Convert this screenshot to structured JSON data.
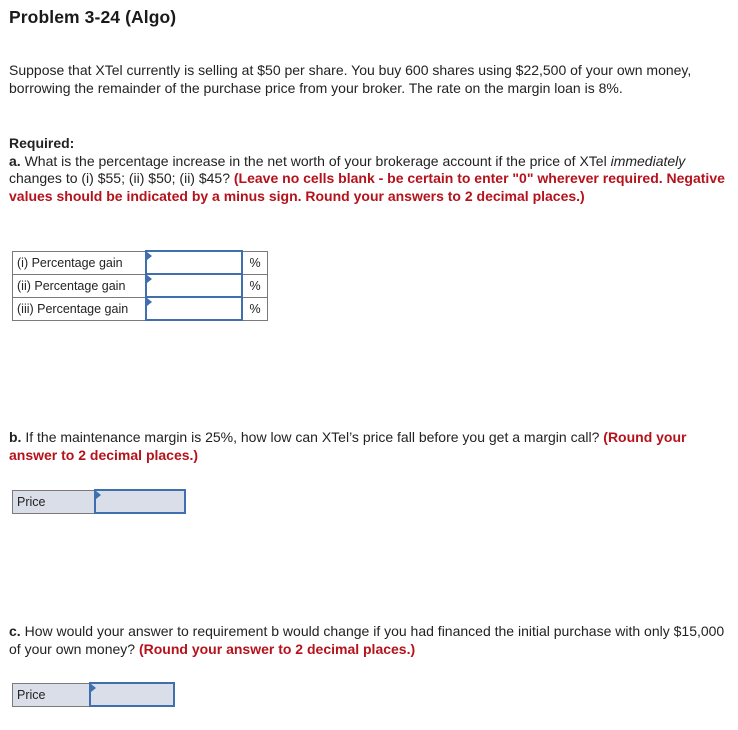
{
  "problem": {
    "title": "Problem 3-24 (Algo)",
    "intro": "Suppose that XTel currently is selling at $50 per share. You buy 600 shares using $22,500 of your own money, borrowing the remainder of the purchase price from your broker. The rate on the margin loan is 8%."
  },
  "required": {
    "heading": "Required:",
    "part_a": {
      "letter": "a.",
      "text_before_italic": " What is the percentage increase in the net worth of your brokerage account if the price of XTel ",
      "italic": "immediately",
      "text_after_italic": " changes to (i) $55; (ii) $50; (ii) $45? ",
      "instruction": "(Leave no cells blank - be certain to enter \"0\" wherever required. Negative values should be indicated by a minus sign. Round your answers to 2 decimal places.)",
      "rows": [
        {
          "label": "(i) Percentage gain",
          "value": "",
          "unit": "%"
        },
        {
          "label": "(ii) Percentage gain",
          "value": "",
          "unit": "%"
        },
        {
          "label": "(iii) Percentage gain",
          "value": "",
          "unit": "%"
        }
      ]
    },
    "part_b": {
      "letter": "b.",
      "text": " If the maintenance margin is 25%, how low can XTel’s price fall before you get a margin call? ",
      "instruction": "(Round your answer to 2 decimal places.)",
      "row": {
        "label": "Price",
        "value": ""
      }
    },
    "part_c": {
      "letter": "c.",
      "text": " How would your answer to requirement b would change if you had financed the initial purchase with only $15,000 of your own money? ",
      "instruction": "(Round your answer to 2 decimal places.)",
      "row": {
        "label": "Price",
        "value": ""
      }
    }
  },
  "colors": {
    "instruction_red": "#b5121b",
    "input_border_blue": "#3f6fae",
    "shaded_cell": "#dadee8"
  }
}
